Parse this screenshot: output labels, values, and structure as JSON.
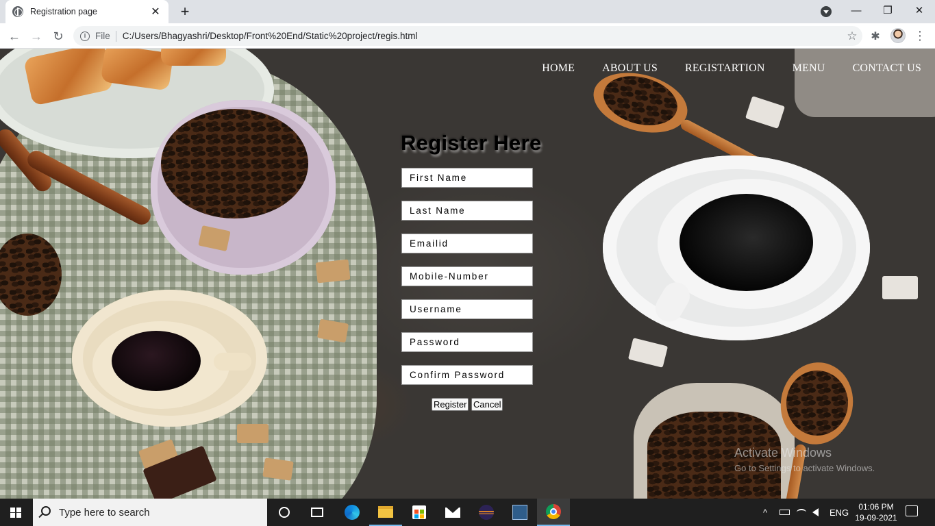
{
  "browser": {
    "tab_title": "Registration page",
    "tab_close": "✕",
    "new_tab": "+",
    "scheme_label": "File",
    "url": "C:/Users/Bhagyashri/Desktop/Front%20End/Static%20project/regis.html",
    "info_icon_glyph": "i",
    "bookmark_icon_glyph": "☆",
    "extensions_icon_glyph": "✱",
    "menu_glyph": "⋮",
    "back_glyph": "←",
    "forward_glyph": "→",
    "reload_glyph": "↻",
    "window_controls": {
      "minimize": "—",
      "restore": "❐",
      "close": "✕"
    }
  },
  "site_nav": {
    "items": [
      "HOME",
      "ABOUT US",
      "REGISTARTION",
      "MENU",
      "CONTACT US"
    ]
  },
  "form": {
    "title": "Register Here",
    "fields": {
      "first_name": " First Name",
      "last_name": "Last Name",
      "email": "Emailid",
      "mobile": "Mobile-Number",
      "username": "Username",
      "password": "Password",
      "confirm_password": " Confirm Password"
    },
    "register_label": "Register",
    "cancel_label": "Cancel"
  },
  "watermark": {
    "line1": "Activate Windows",
    "line2": "Go to Settings to activate Windows."
  },
  "taskbar": {
    "search_placeholder": "Type here to search",
    "tray_lang": "ENG",
    "tray_expand_glyph": "^",
    "time": "01:06 PM",
    "date": "19-09-2021"
  },
  "colors": {
    "tabstrip": "#dee1e6",
    "page_background": "#3a3734",
    "nav_text": "#ffffff",
    "taskbar": "#1f1f1f",
    "taskbar_accent": "#76b9ed"
  }
}
